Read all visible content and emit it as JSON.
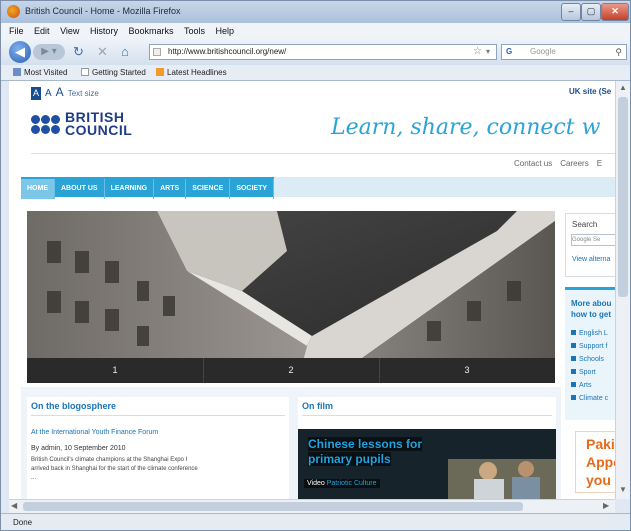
{
  "window": {
    "title": "British Council - Home - Mozilla Firefox"
  },
  "menu": [
    "File",
    "Edit",
    "View",
    "History",
    "Bookmarks",
    "Tools",
    "Help"
  ],
  "address": {
    "url": "http://www.britishcouncil.org/new/"
  },
  "search": {
    "engine": "G",
    "placeholder": "Google"
  },
  "bookmarks": [
    "Most Visited",
    "Getting Started",
    "Latest Headlines"
  ],
  "status": "Done",
  "site": {
    "text_size": {
      "a1": "A",
      "a2": "A",
      "a3": "A",
      "label": "Text size"
    },
    "uk_site": "UK site (Se",
    "logo": {
      "line1": "BRITISH",
      "line2": "COUNCIL"
    },
    "slogan": "Learn, share, connect w",
    "util_links": [
      "Contact us",
      "Careers",
      "E"
    ],
    "nav": [
      "HOME",
      "ABOUT US",
      "LEARNING",
      "ARTS",
      "SCIENCE",
      "SOCIETY"
    ],
    "slides": [
      "1",
      "2",
      "3"
    ],
    "search_box": {
      "label": "Search",
      "placeholder": "Google Se",
      "link": "View alterna"
    },
    "more_about": {
      "heading_line1": "More abou",
      "heading_line2": "how to get",
      "items": [
        "English L",
        "Support f",
        "Schools",
        "Sport",
        "Arts",
        "Climate c"
      ]
    },
    "ad": [
      "Pakis",
      "Appe",
      "you c"
    ],
    "blog": {
      "heading": "On the blogosphere",
      "title": "At the International Youth Finance Forum",
      "meta": "By admin, 10 September 2010",
      "body1": "British Council's climate champions at the Shanghai Expo I",
      "body2": "arrived back in Shanghai for the start of the climate conference",
      "body3": "..."
    },
    "film": {
      "heading": "On film",
      "caption_line1": "Chinese lessons for",
      "caption_line2": "primary pupils",
      "play_label": "Video",
      "play_sub": "Patriotic Culture"
    }
  }
}
